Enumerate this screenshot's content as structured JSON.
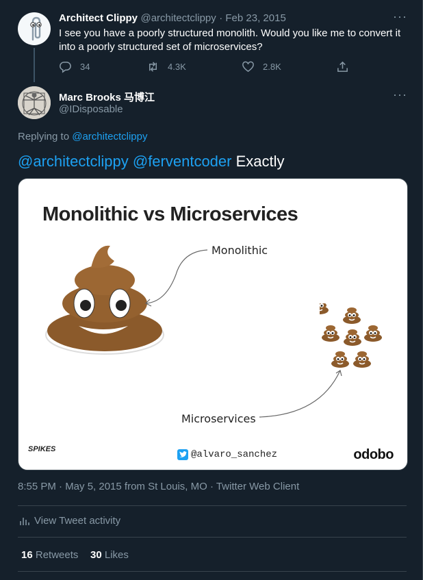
{
  "parent_tweet": {
    "author_name": "Architect Clippy",
    "author_handle": "@architectclippy",
    "date": "· Feb 23, 2015",
    "text": "I see you have a poorly structured monolith. Would you like me to convert it into a poorly structured set of microservices?",
    "replies": "34",
    "retweets": "4.3K",
    "likes": "2.8K"
  },
  "main_tweet": {
    "author_name": "Marc Brooks 马博江",
    "author_handle": "@IDisposable",
    "replying_prefix": "Replying to",
    "replying_to": "@architectclippy",
    "mention_1": "@architectclippy",
    "mention_2": "@ferventcoder",
    "text": "Exactly",
    "timestamp": "8:55 PM · May 5, 2015 from St Louis, MO · Twitter Web Client",
    "activity_label": "View Tweet activity",
    "retweets_count": "16",
    "retweets_label": "Retweets",
    "likes_count": "30",
    "likes_label": "Likes"
  },
  "image": {
    "title": "Monolithic vs Microservices",
    "label_monolithic": "Monolithic",
    "label_microservices": "Microservices",
    "twitter_handle": "@alvaro_sanchez",
    "brand": "odobo",
    "logo_text": "SPIKES"
  },
  "colors": {
    "background": "#15202b",
    "accent": "#1da1f2",
    "muted": "#8899a6",
    "border": "#38444d"
  }
}
